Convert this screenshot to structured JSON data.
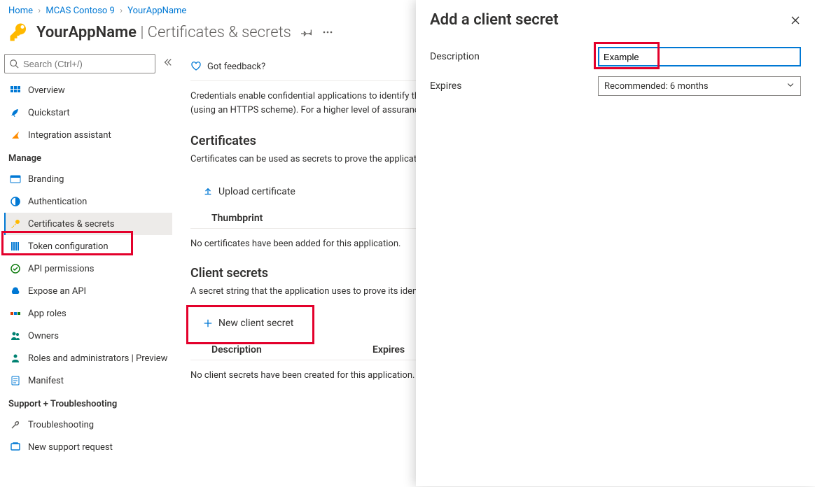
{
  "breadcrumb": {
    "home": "Home",
    "tenant": "MCAS Contoso 9",
    "app": "YourAppName"
  },
  "header": {
    "app_name": "YourAppName",
    "section": "Certificates & secrets"
  },
  "search": {
    "placeholder": "Search (Ctrl+/)"
  },
  "nav": {
    "overview": "Overview",
    "quickstart": "Quickstart",
    "integration": "Integration assistant",
    "group_manage": "Manage",
    "branding": "Branding",
    "authentication": "Authentication",
    "certs": "Certificates & secrets",
    "token": "Token configuration",
    "api_perm": "API permissions",
    "expose": "Expose an API",
    "app_roles": "App roles",
    "owners": "Owners",
    "roles_admins": "Roles and administrators | Preview",
    "manifest": "Manifest",
    "group_support": "Support + Troubleshooting",
    "troubleshooting": "Troubleshooting",
    "new_request": "New support request"
  },
  "main": {
    "feedback": "Got feedback?",
    "intro": "Credentials enable confidential applications to identify themselves to the authentication service when receiving tokens at a web addressable location (using an HTTPS scheme). For a higher level of assurance, we recommend using a certificate (instead of a client secret) as a credential.",
    "certs_title": "Certificates",
    "certs_sub": "Certificates can be used as secrets to prove the application's identity when requesting a token. Also can be referred to as public keys.",
    "upload_btn": "Upload certificate",
    "thumbprint": "Thumbprint",
    "certs_empty": "No certificates have been added for this application.",
    "secrets_title": "Client secrets",
    "secrets_sub": "A secret string that the application uses to prove its identity when requesting a token. Also can be referred to as application password.",
    "new_secret_btn": "New client secret",
    "col_description": "Description",
    "col_expires": "Expires",
    "secrets_empty": "No client secrets have been created for this application."
  },
  "panel": {
    "title": "Add a client secret",
    "label_description": "Description",
    "label_expires": "Expires",
    "desc_value": "Example",
    "expires_value": "Recommended: 6 months"
  }
}
